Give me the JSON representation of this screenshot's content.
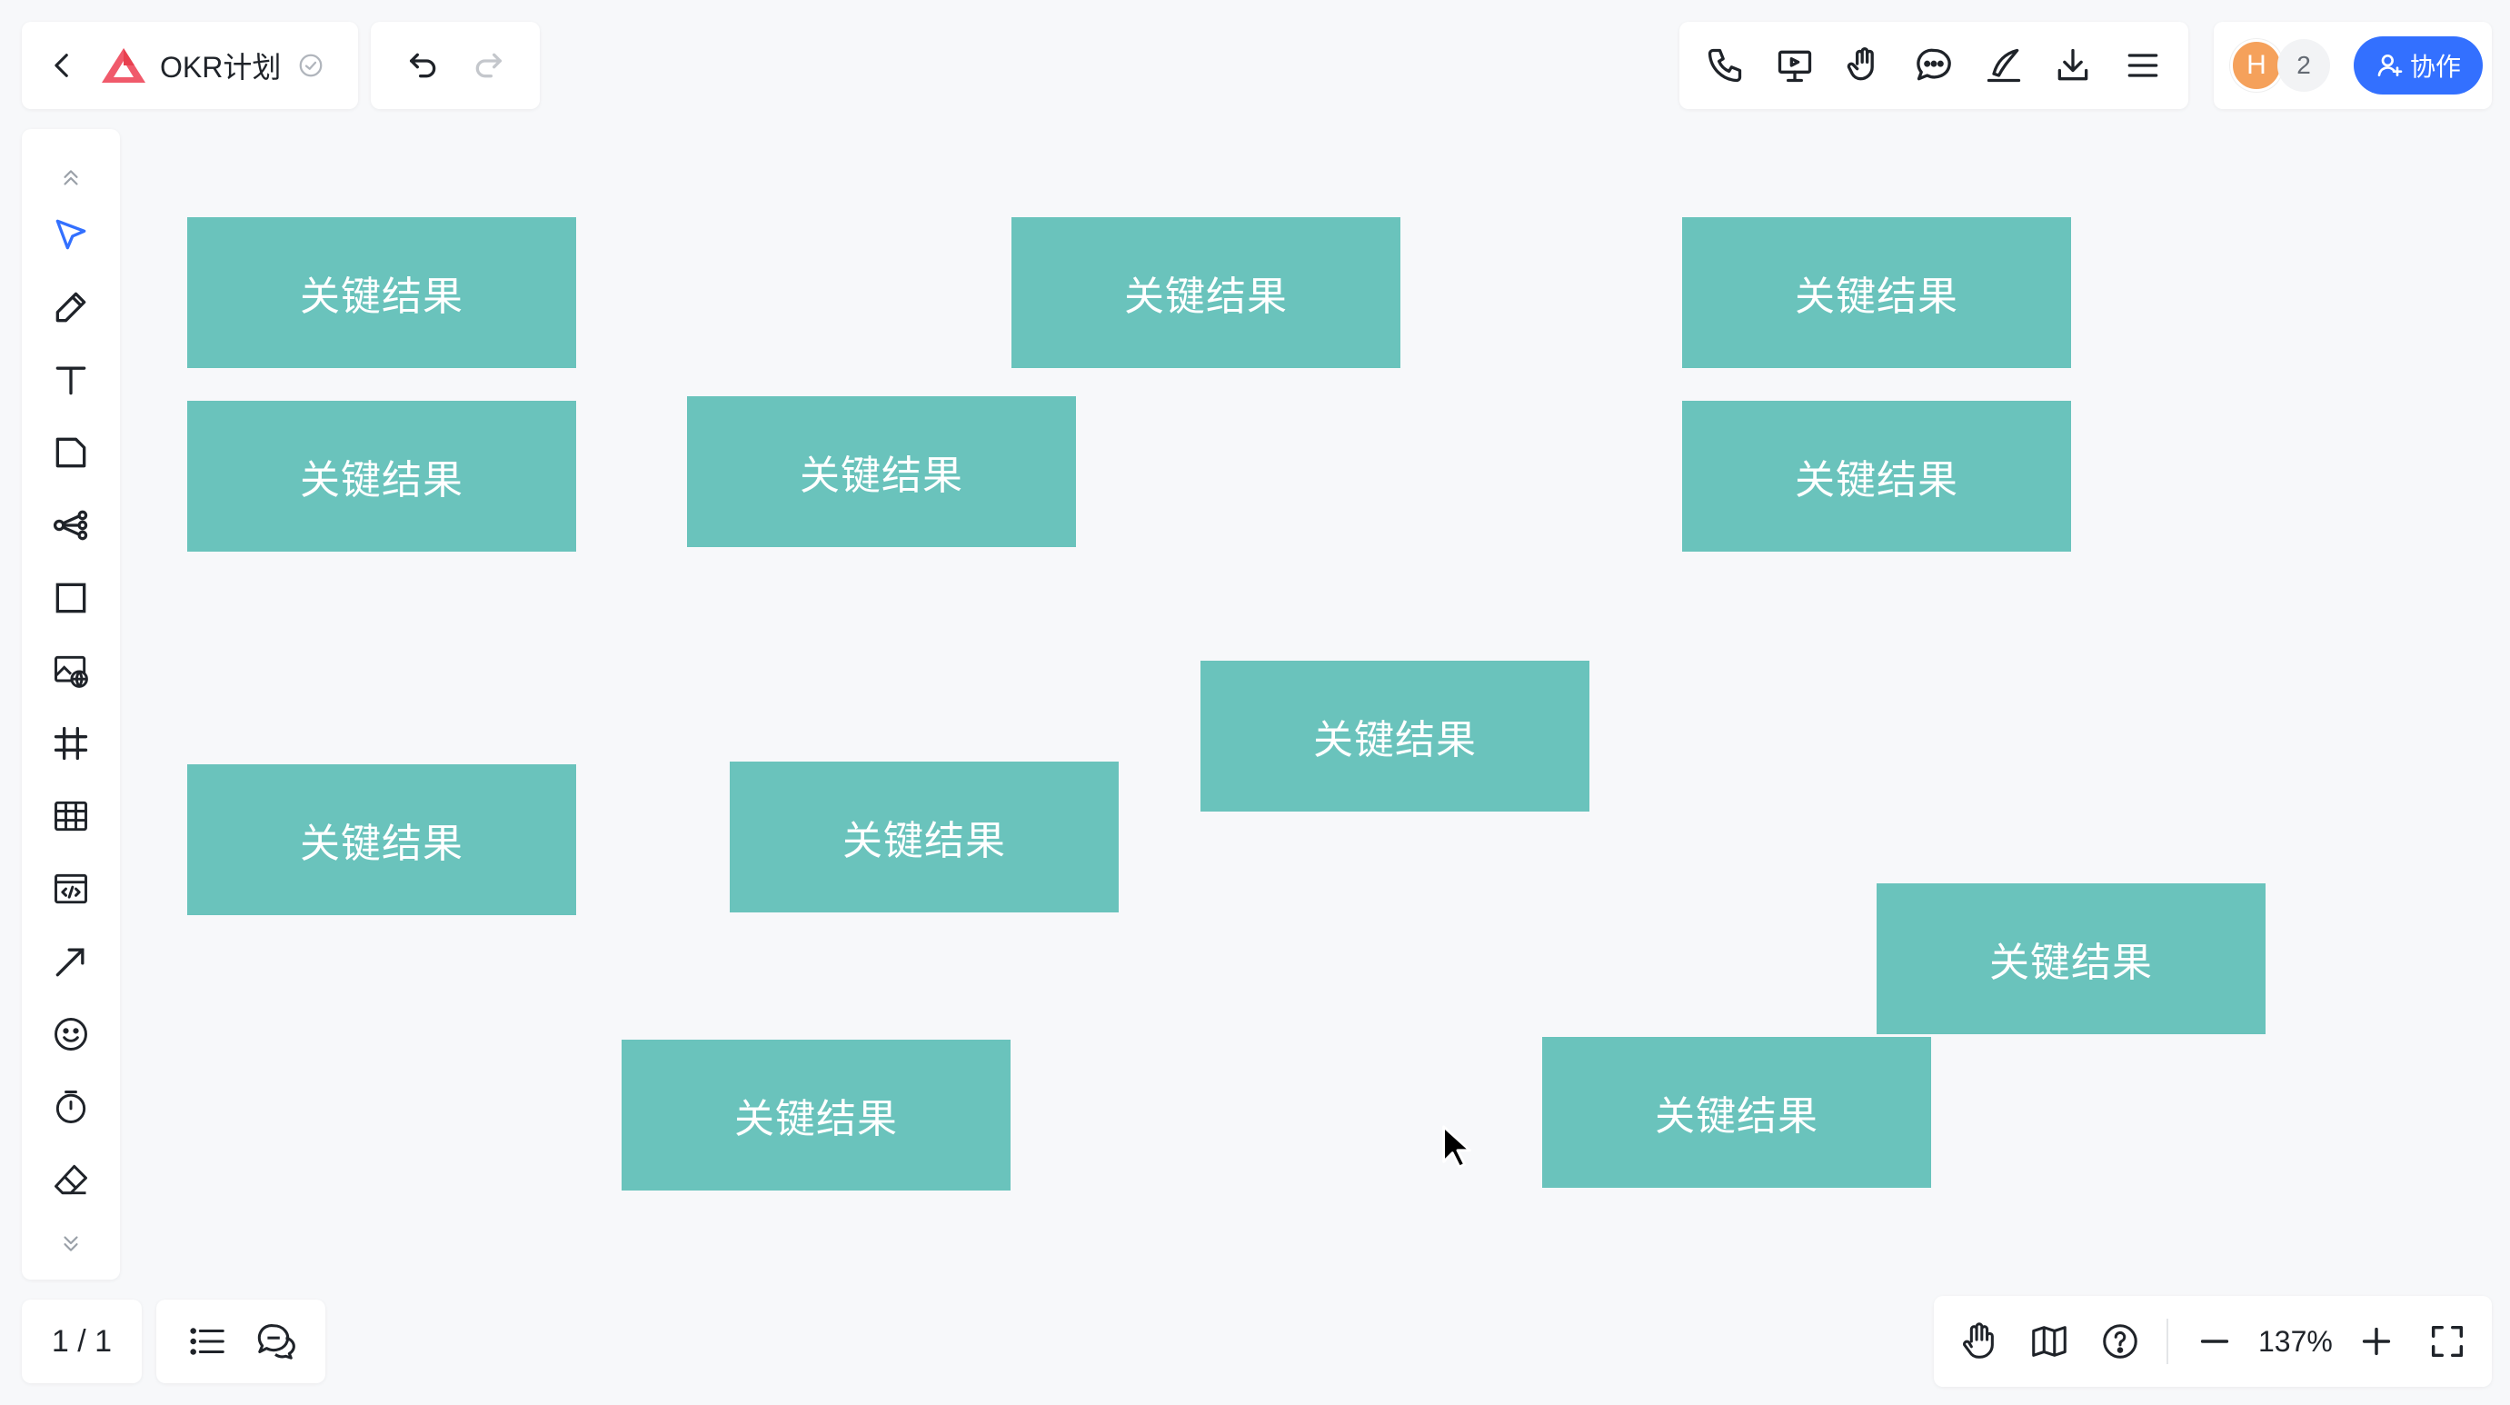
{
  "doc": {
    "title": "OKR计划",
    "back_icon": "chevron-left-icon",
    "logo_icon": "app-logo-triangle",
    "saved_icon": "saved-check-icon",
    "brand_color": "#f05a6b"
  },
  "history": {
    "undo_icon": "undo-icon",
    "redo_icon": "redo-icon"
  },
  "tools": [
    "phone-icon",
    "present-icon",
    "hand-raise-icon",
    "comment-icon",
    "sign-pen-icon",
    "download-icon",
    "menu-icon"
  ],
  "collab": {
    "avatar_initial": "H",
    "avatar_color": "#f5a15b",
    "user_count": "2",
    "button_label": "协作",
    "button_color": "#3370ff"
  },
  "left_toolbar": [
    "collapse-up-icon",
    "select-icon",
    "pen-icon",
    "text-icon",
    "sticky-note-icon",
    "mindmap-icon",
    "shape-icon",
    "image-icon",
    "frame-icon",
    "table-icon",
    "embed-icon",
    "arrow-icon",
    "emoji-icon",
    "timer-icon",
    "eraser-icon",
    "expand-down-icon"
  ],
  "page": {
    "indicator": "1 / 1"
  },
  "outline": [
    "outline-list-icon",
    "comments-icon"
  ],
  "view": {
    "zoom_level": "137%",
    "icons": [
      "hand-icon",
      "map-icon",
      "help-icon",
      "zoom-out-icon",
      "zoom-in-icon",
      "fullscreen-icon"
    ]
  },
  "canvas": {
    "card_color": "#6ac3bc",
    "cards": [
      {
        "label": "关键结果"
      },
      {
        "label": "关键结果"
      },
      {
        "label": "关键结果"
      },
      {
        "label": "关键结果"
      },
      {
        "label": "关键结果"
      },
      {
        "label": "关键结果"
      },
      {
        "label": "关键结果"
      },
      {
        "label": "关键结果"
      },
      {
        "label": "关键结果"
      },
      {
        "label": "关键结果"
      },
      {
        "label": "关键结果"
      },
      {
        "label": "关键结果"
      }
    ]
  }
}
